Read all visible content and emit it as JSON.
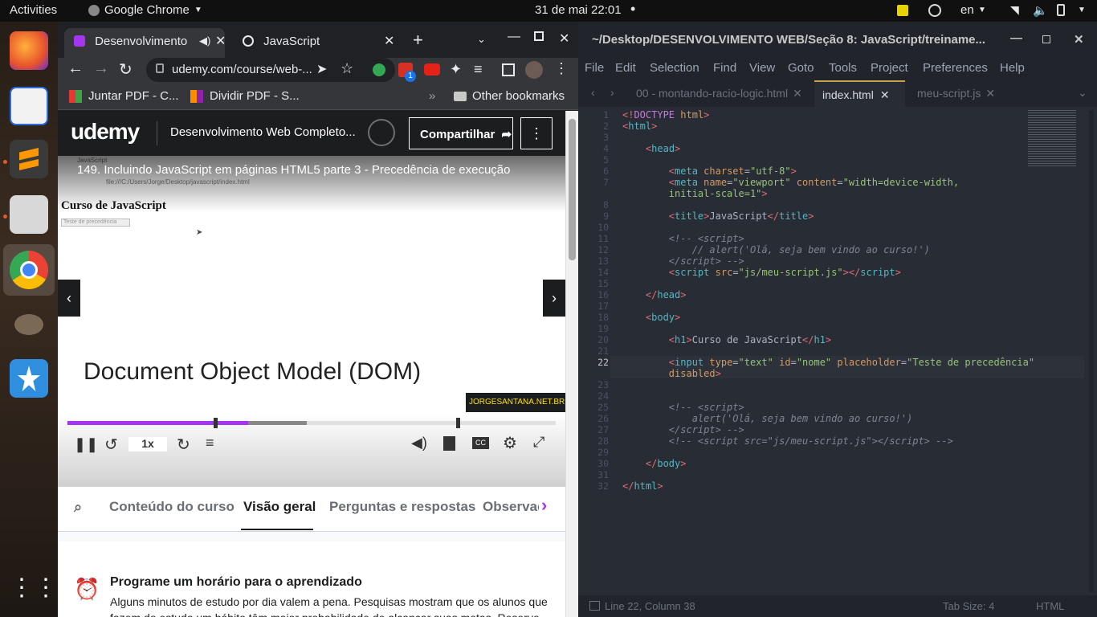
{
  "topbar": {
    "activities": "Activities",
    "app_menu": "Google Chrome",
    "datetime": "31 de mai  22:01",
    "language": "en"
  },
  "chrome": {
    "tabs": [
      {
        "title": "Desenvolvimento"
      },
      {
        "title": "JavaScript"
      }
    ],
    "url": "udemy.com/course/web-...",
    "bookmarks": [
      "Juntar PDF - C...",
      "Dividir PDF - S..."
    ],
    "other_bookmarks": "Other bookmarks",
    "extension_badge": "1"
  },
  "udemy": {
    "logo": "udemy",
    "course_title": "Desenvolvimento Web Completo...",
    "share_label": "Compartilhar",
    "lecture_title": "149. Incluindo JavaScript em páginas HTML5 parte 3 - Precedência de execução",
    "video_inner": {
      "url": "file:///C:/Users/Jorge/Desktop/javascript/index.html",
      "tab": "JavaScript",
      "heading": "Curso de JavaScript",
      "input_placeholder": "Teste de precedência",
      "slide_title": "Document Object Model (DOM)",
      "watermark": "JORGESANTANA.NET.BR"
    },
    "player": {
      "speed": "1x",
      "progress": 0.37,
      "buffered": 0.49
    },
    "tabs": [
      "Conteúdo do curso",
      "Visão geral",
      "Perguntas e respostas",
      "Observaç"
    ],
    "active_tab": "Visão geral",
    "reminder": {
      "title": "Programe um horário para o aprendizado",
      "text": "Alguns minutos de estudo por dia valem a pena. Pesquisas mostram que os alunos que fazem do estudo um hábito têm maior probabilidade de alcançar suas metas. Reserve um tempo para estudar e receba lembretes usando seu programador de aprendizado."
    }
  },
  "editor": {
    "title": "~/Desktop/DESENVOLVIMENTO WEB/Seção 8: JavaScript/treiname...",
    "menu": [
      "File",
      "Edit",
      "Selection",
      "Find",
      "View",
      "Goto",
      "Tools",
      "Project",
      "Preferences",
      "Help"
    ],
    "tabs": [
      "00 - montando-racio-logic.html",
      "index.html",
      "meu-script.js"
    ],
    "active_tab": "index.html",
    "status_left": "Line 22, Column 38",
    "tab_size": "Tab Size: 4",
    "syntax": "HTML"
  }
}
